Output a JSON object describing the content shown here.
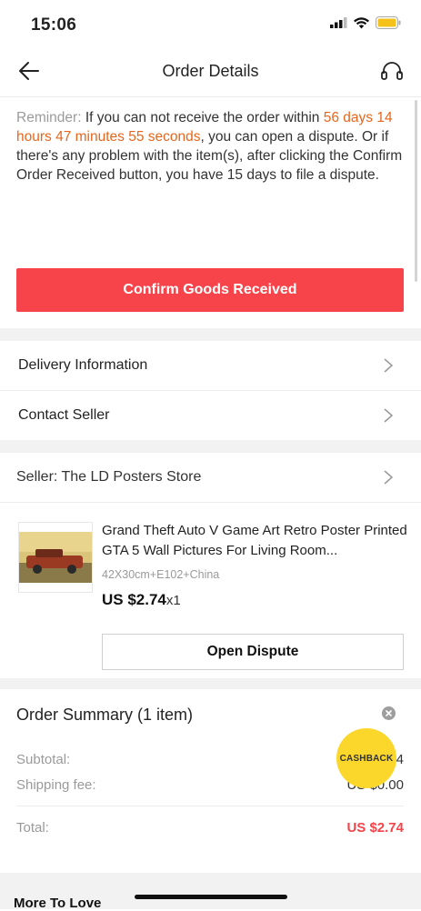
{
  "status_bar": {
    "time": "15:06"
  },
  "header": {
    "title": "Order Details"
  },
  "reminder": {
    "prefix": "Reminder: ",
    "text1": "If you can not receive the order within ",
    "countdown": "56 days 14 hours 47 minutes 55 seconds",
    "text2": ", you can open a dispute. Or if there's any problem with the item(s), after clicking the Confirm Order Received button, you have 15 days to file a dispute."
  },
  "confirm_button": "Confirm Goods Received",
  "menu": {
    "delivery": "Delivery Information",
    "contact": "Contact Seller",
    "seller": "Seller: The LD Posters Store"
  },
  "product": {
    "title": "Grand Theft Auto V Game Art Retro Poster Printed GTA 5 Wall Pictures For Living Room...",
    "sku": "42X30cm+E102+China",
    "price": "US $2.74",
    "qty": "x1",
    "dispute_button": "Open Dispute"
  },
  "summary": {
    "title": "Order Summary (1 item)",
    "subtotal_label": "Subtotal:",
    "subtotal_value": "4",
    "shipping_label": "Shipping fee:",
    "shipping_value": "US $0.00",
    "total_label": "Total:",
    "total_value": "US $2.74"
  },
  "cashback": "CASHBACK",
  "more_to_love": "More To Love",
  "colors": {
    "accent": "#f6444a",
    "countdown": "#e8661c",
    "cashback": "#fbd72b"
  }
}
